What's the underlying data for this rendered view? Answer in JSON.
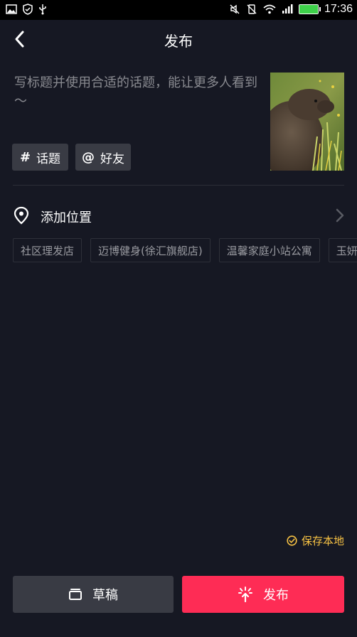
{
  "status_bar": {
    "time": "17:36",
    "battery_color": "#3ed14a"
  },
  "header": {
    "title": "发布"
  },
  "caption": {
    "placeholder": "写标题并使用合适的话题，能让更多人看到～"
  },
  "chips": [
    {
      "symbol": "#",
      "label": "话题"
    },
    {
      "symbol": "@",
      "label": "好友"
    }
  ],
  "location": {
    "label": "添加位置",
    "suggestions": [
      "社区理发店",
      "迈博健身(徐汇旗舰店)",
      "温馨家庭小站公寓",
      "玉妍"
    ]
  },
  "save_local": {
    "label": "保存本地",
    "color": "#f7c244"
  },
  "buttons": {
    "draft_label": "草稿",
    "publish_label": "发布",
    "publish_color": "#fe2c55"
  }
}
